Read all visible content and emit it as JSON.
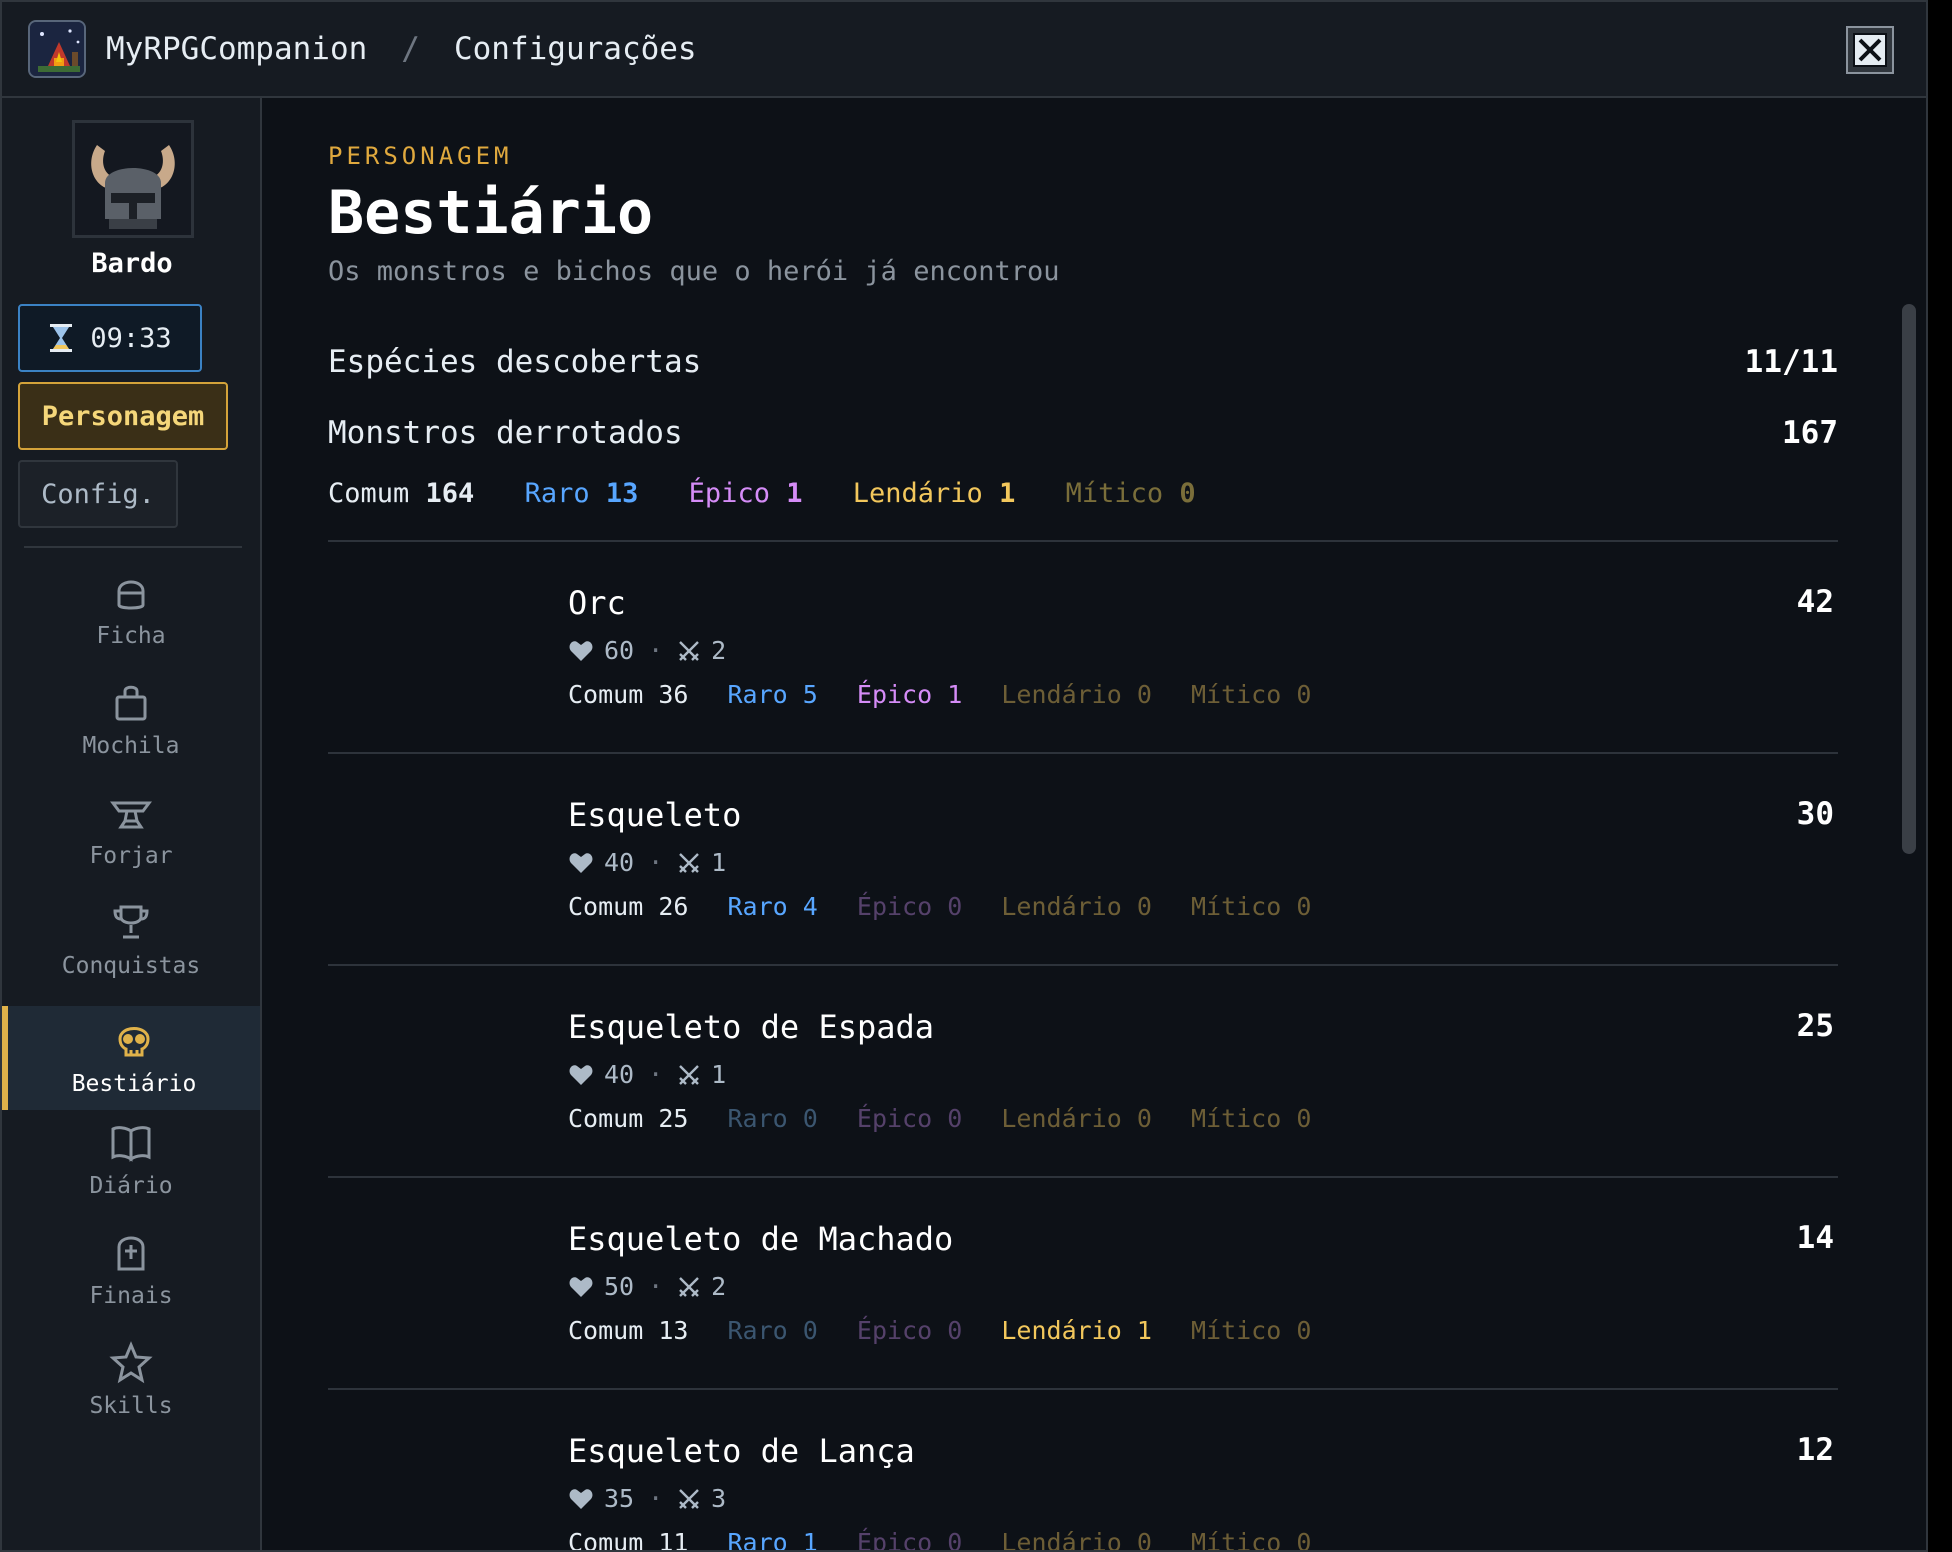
{
  "titlebar": {
    "app_name": "MyRPGCompanion",
    "separator": "/",
    "section": "Configurações",
    "close_icon": "close-icon"
  },
  "sidebar": {
    "character_name": "Bardo",
    "timer": "09:33",
    "tab_personagem": "Personagem",
    "tab_config": "Config.",
    "nav": [
      {
        "label": "Ficha",
        "icon": "helmet-icon"
      },
      {
        "label": "Mochila",
        "icon": "bag-icon"
      },
      {
        "label": "Forjar",
        "icon": "anvil-icon"
      },
      {
        "label": "Conquistas",
        "icon": "trophy-icon"
      },
      {
        "label": "Bestiário",
        "icon": "skull-icon",
        "active": true
      },
      {
        "label": "Diário",
        "icon": "book-icon"
      },
      {
        "label": "Finais",
        "icon": "tombstone-icon"
      },
      {
        "label": "Skills",
        "icon": "star-icon"
      }
    ]
  },
  "main": {
    "eyebrow": "PERSONAGEM",
    "title": "Bestiário",
    "subtitle": "Os monstros e bichos que o herói já encontrou",
    "species_label": "Espécies descobertas",
    "species_value": "11/11",
    "defeated_label": "Monstros derrotados",
    "defeated_value": "167",
    "totals": {
      "common_label": "Comum",
      "common": "164",
      "rare_label": "Raro",
      "rare": "13",
      "epic_label": "Épico",
      "epic": "1",
      "legend_label": "Lendário",
      "legend": "1",
      "mythic_label": "Mítico",
      "mythic": "0"
    },
    "dot": "·",
    "monsters": [
      {
        "name": "Orc",
        "count": "42",
        "hp": "60",
        "atk": "2",
        "common": "36",
        "rare": "5",
        "epic": "1",
        "legend": "0",
        "mythic": "0"
      },
      {
        "name": "Esqueleto",
        "count": "30",
        "hp": "40",
        "atk": "1",
        "common": "26",
        "rare": "4",
        "epic": "0",
        "legend": "0",
        "mythic": "0"
      },
      {
        "name": "Esqueleto de Espada",
        "count": "25",
        "hp": "40",
        "atk": "1",
        "common": "25",
        "rare": "0",
        "epic": "0",
        "legend": "0",
        "mythic": "0"
      },
      {
        "name": "Esqueleto de Machado",
        "count": "14",
        "hp": "50",
        "atk": "2",
        "common": "13",
        "rare": "0",
        "epic": "0",
        "legend": "1",
        "mythic": "0"
      },
      {
        "name": "Esqueleto de Lança",
        "count": "12",
        "hp": "35",
        "atk": "3",
        "common": "11",
        "rare": "1",
        "epic": "0",
        "legend": "0",
        "mythic": "0"
      }
    ]
  }
}
